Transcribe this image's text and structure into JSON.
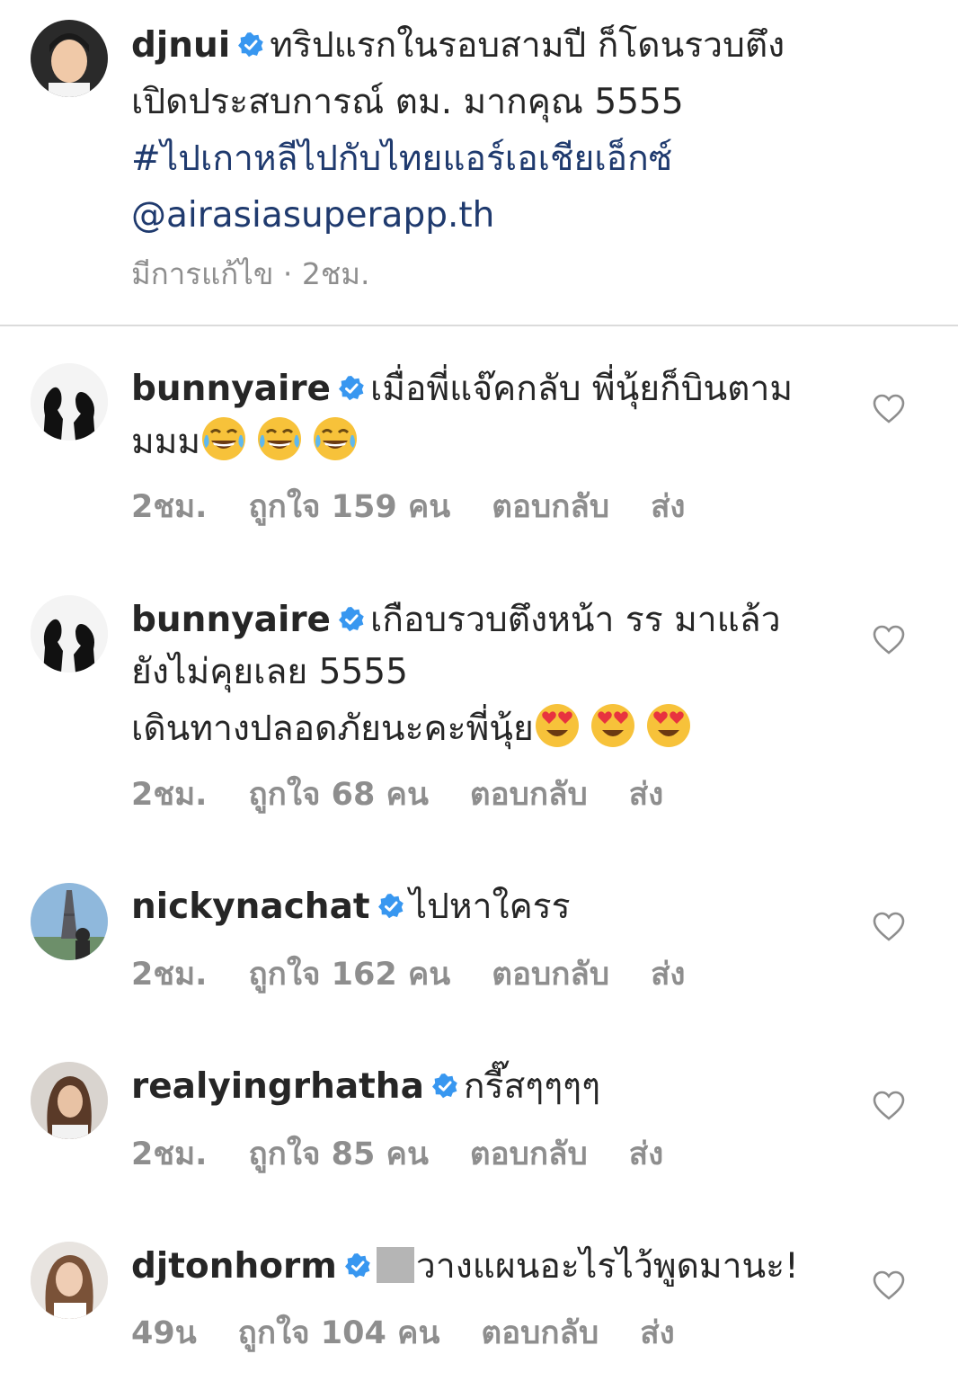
{
  "caption": {
    "username": "djnui",
    "lines": [
      "ทริปแรกในรอบสามปี ก็โดนรวบตึง",
      "เปิดประสบการณ์ ตม. มากคุณ 5555"
    ],
    "hashtag": "#ไปเกาหลีไปกับไทยแอร์เอเชียเอ็กซ์",
    "mention": "@airasiasuperapp.th",
    "meta": "มีการแก้ไข · 2ชม."
  },
  "comments": [
    {
      "username": "bunnyaire",
      "lines": [
        "เมื่อพี่แจ๊คกลับ พี่นุ้ยก็บินตาม",
        "มมม"
      ],
      "emojis": [
        "face-with-tears-of-joy-icon",
        "face-with-tears-of-joy-icon",
        "face-with-tears-of-joy-icon"
      ],
      "time": "2ชม.",
      "likes": "ถูกใจ 159 คน",
      "reply": "ตอบกลับ",
      "send": "ส่ง"
    },
    {
      "username": "bunnyaire",
      "lines": [
        "เกือบรวบตึงหน้า รร มาแล้ว",
        "ยังไม่คุยเลย 5555",
        "เดินทางปลอดภัยนะคะพี่นุ้ย"
      ],
      "emojis": [
        "smiling-face-with-heart-eyes-icon",
        "smiling-face-with-heart-eyes-icon",
        "smiling-face-with-heart-eyes-icon"
      ],
      "time": "2ชม.",
      "likes": "ถูกใจ 68 คน",
      "reply": "ตอบกลับ",
      "send": "ส่ง"
    },
    {
      "username": "nickynachat",
      "lines": [
        "ไปหาใครร"
      ],
      "time": "2ชม.",
      "likes": "ถูกใจ 162 คน",
      "reply": "ตอบกลับ",
      "send": "ส่ง"
    },
    {
      "username": "realyingrhatha",
      "lines": [
        "กรี๊สๆๆๆๆ"
      ],
      "time": "2ชม.",
      "likes": "ถูกใจ 85 คน",
      "reply": "ตอบกลับ",
      "send": "ส่ง"
    },
    {
      "username": "djtonhorm",
      "lines": [
        "วางแผนอะไรไว้พูดมานะ!"
      ],
      "time": "49น",
      "likes": "ถูกใจ 104 คน",
      "reply": "ตอบกลับ",
      "send": "ส่ง"
    }
  ],
  "colors": {
    "text": "#262626",
    "meta": "#8e8e8e",
    "verified": "#3897f0",
    "link": "#1f3a6e",
    "divider": "#dbdbdb"
  }
}
